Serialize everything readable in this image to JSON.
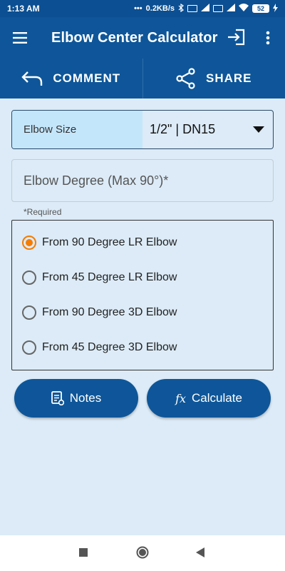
{
  "status_bar": {
    "time": "1:13 AM",
    "net_speed": "0.2KB/s",
    "battery": "52"
  },
  "app_bar": {
    "title": "Elbow Center Calculator"
  },
  "actions": {
    "comment": "COMMENT",
    "share": "SHARE"
  },
  "elbow_size": {
    "label": "Elbow Size",
    "value": "1/2\" | DN15"
  },
  "elbow_degree": {
    "placeholder": "Elbow Degree (Max 90°)*",
    "helper": "*Required"
  },
  "options": [
    {
      "label": "From 90 Degree LR Elbow",
      "checked": true
    },
    {
      "label": "From 45 Degree LR Elbow",
      "checked": false
    },
    {
      "label": "From 90 Degree 3D Elbow",
      "checked": false
    },
    {
      "label": "From 45 Degree 3D Elbow",
      "checked": false
    }
  ],
  "buttons": {
    "notes": "Notes",
    "calculate": "Calculate",
    "calc_icon": "fx"
  },
  "colors": {
    "primary": "#0e5699",
    "background": "#dcebf7",
    "accent": "#f57c00",
    "label_bg": "#c4e6fb"
  }
}
